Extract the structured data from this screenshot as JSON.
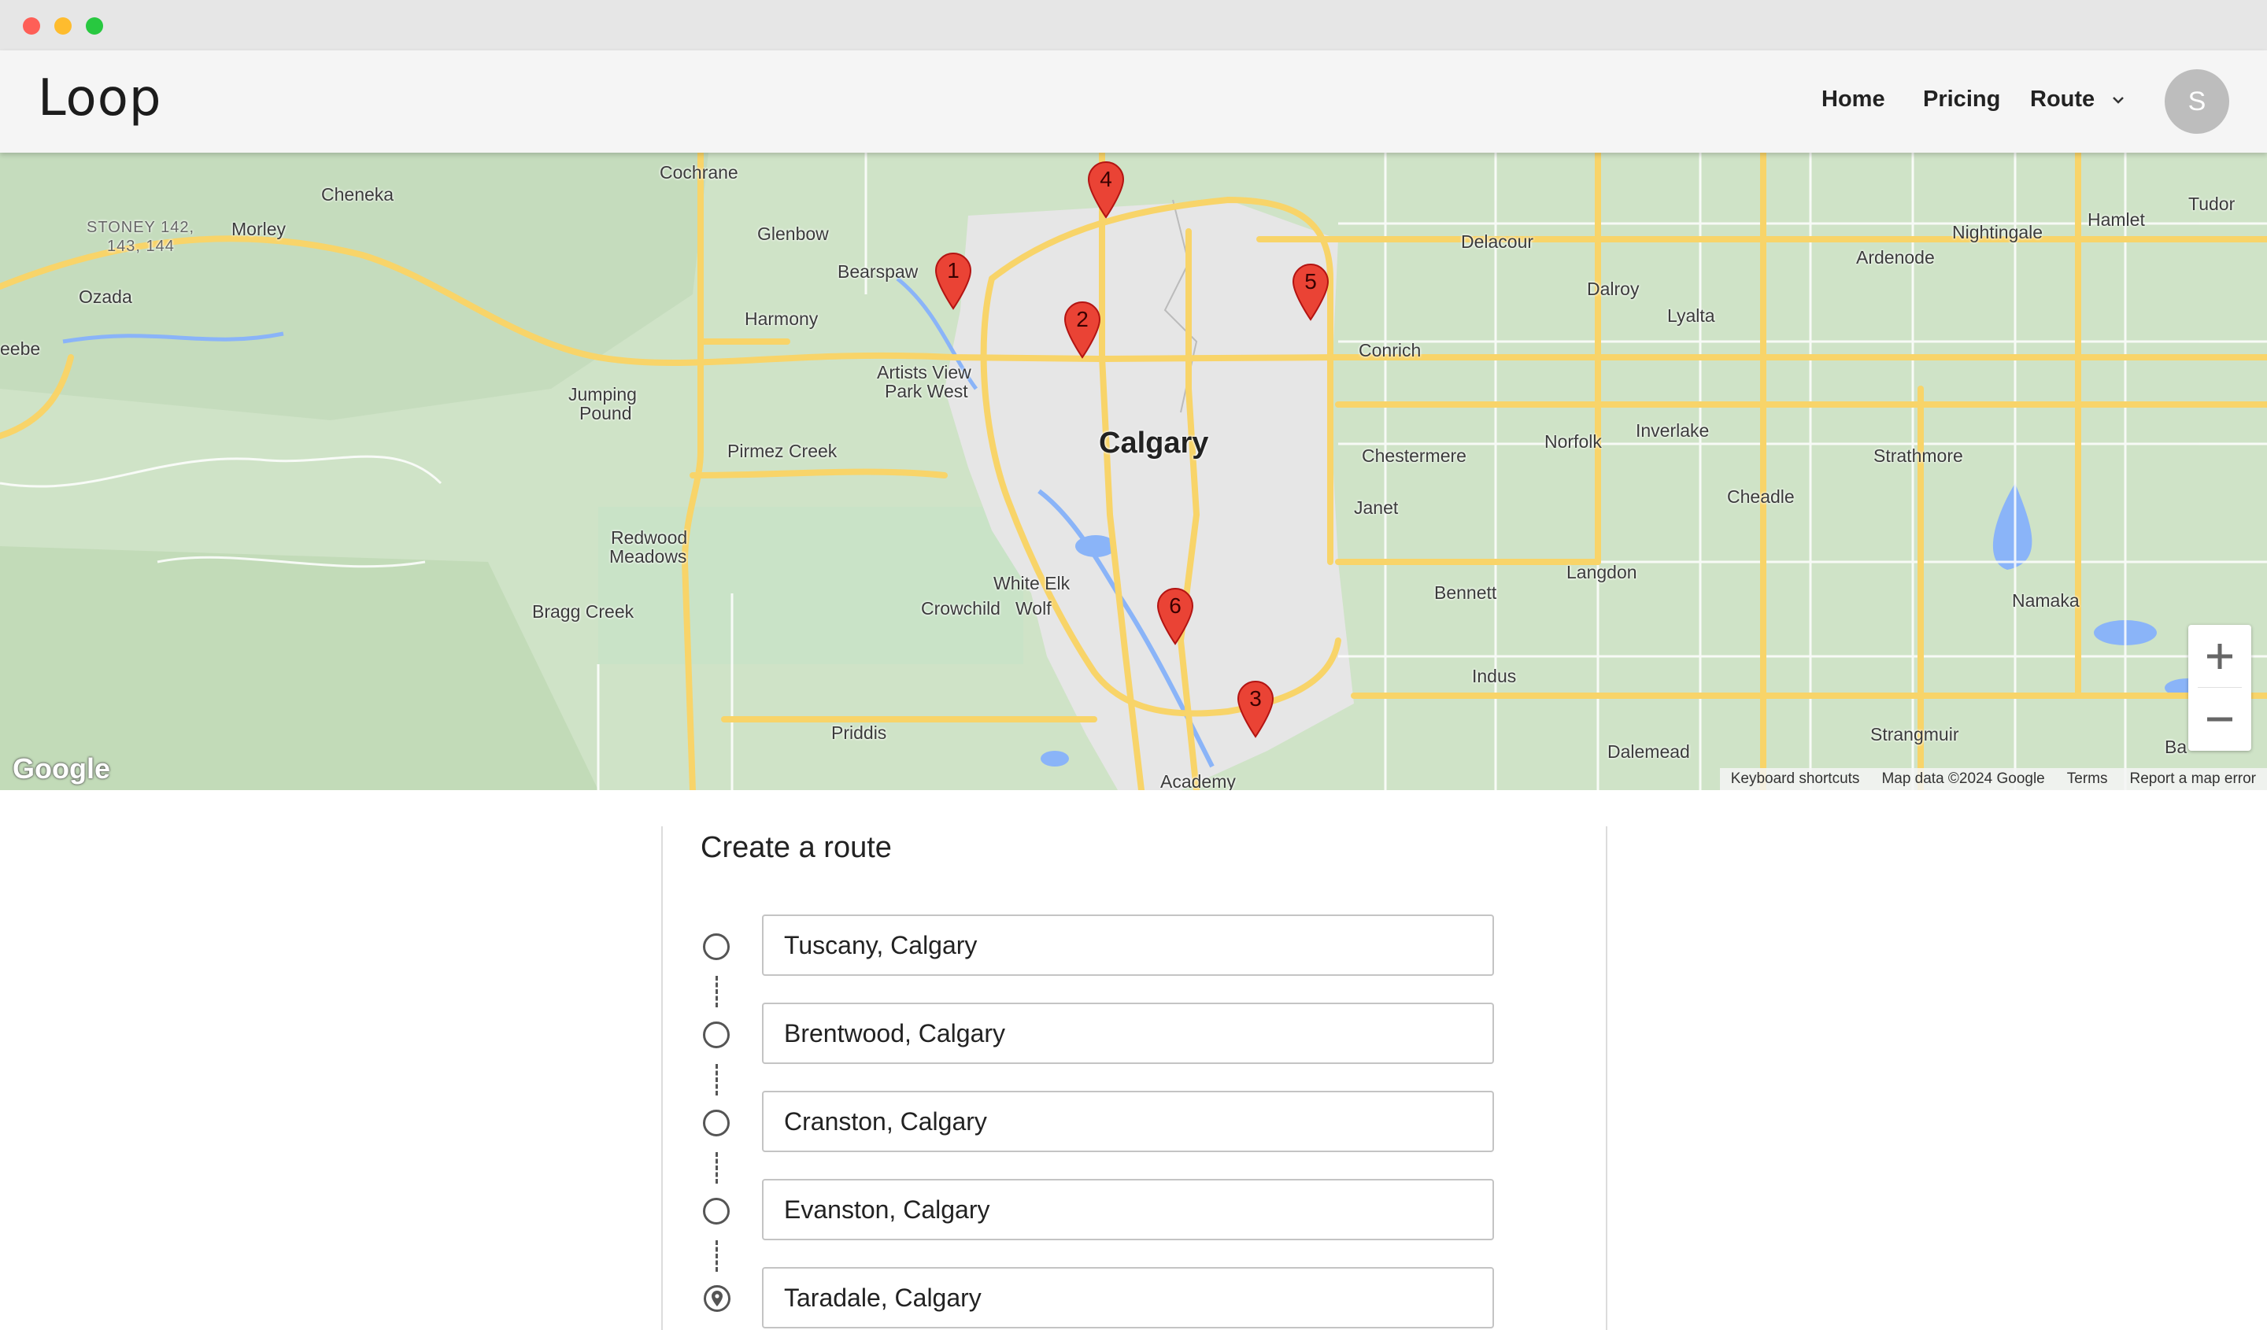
{
  "window": {
    "controls": [
      "close",
      "minimize",
      "maximize"
    ]
  },
  "header": {
    "brand": "Loop",
    "nav": {
      "home": "Home",
      "pricing": "Pricing",
      "route": "Route"
    },
    "avatar_initial": "S"
  },
  "map": {
    "city": "Calgary",
    "labels": {
      "cochrane": "Cochrane",
      "cheneka": "Cheneka",
      "stoney1": "STONEY 142,",
      "stoney2": "143, 144",
      "morley": "Morley",
      "glenbow": "Glenbow",
      "bearspaw": "Bearspaw",
      "ozada": "Ozada",
      "harmony": "Harmony",
      "artists1": "Artists View",
      "artists2": "Park West",
      "jumping1": "Jumping",
      "jumping2": "Pound",
      "pirmez": "Pirmez Creek",
      "redwood1": "Redwood",
      "redwood2": "Meadows",
      "whiteelk": "White Elk",
      "crowchild": "Crowchild",
      "wolf": "Wolf",
      "braggcreek": "Bragg Creek",
      "priddis": "Priddis",
      "academy": "Academy",
      "delacour": "Delacour",
      "dalroy": "Dalroy",
      "lyalta": "Lyalta",
      "conrich": "Conrich",
      "nightingale": "Nightingale",
      "ardenode": "Ardenode",
      "hamlet": "Hamlet",
      "tudor": "Tudor",
      "norfolk": "Norfolk",
      "inverlake": "Inverlake",
      "chestermere": "Chestermere",
      "strathmore": "Strathmore",
      "janet": "Janet",
      "cheadle": "Cheadle",
      "langdon": "Langdon",
      "bennett": "Bennett",
      "namaka": "Namaka",
      "indus": "Indus",
      "dalemead": "Dalemead",
      "strangmuir": "Strangmuir",
      "baseline": "Ba",
      "eebe": "eebe"
    },
    "pins": [
      "1",
      "2",
      "3",
      "4",
      "5",
      "6"
    ],
    "zoom_in": "+",
    "zoom_out": "−",
    "logo": "Google",
    "attribution": {
      "shortcuts": "Keyboard shortcuts",
      "data": "Map data ©2024 Google",
      "terms": "Terms",
      "report": "Report a map error"
    },
    "colors": {
      "land": "#cfe3c7",
      "highway": "#f8d469",
      "urban": "#e7e7e7",
      "water": "#8ab4f8",
      "pin": "#ea4335"
    }
  },
  "route_form": {
    "title": "Create a route",
    "stops": [
      {
        "value": "Tuscany, Calgary",
        "icon": "circle-icon"
      },
      {
        "value": "Brentwood, Calgary",
        "icon": "circle-icon"
      },
      {
        "value": "Cranston, Calgary",
        "icon": "circle-icon"
      },
      {
        "value": "Evanston, Calgary",
        "icon": "circle-icon"
      },
      {
        "value": "Taradale, Calgary",
        "icon": "location-pin-icon"
      }
    ]
  }
}
